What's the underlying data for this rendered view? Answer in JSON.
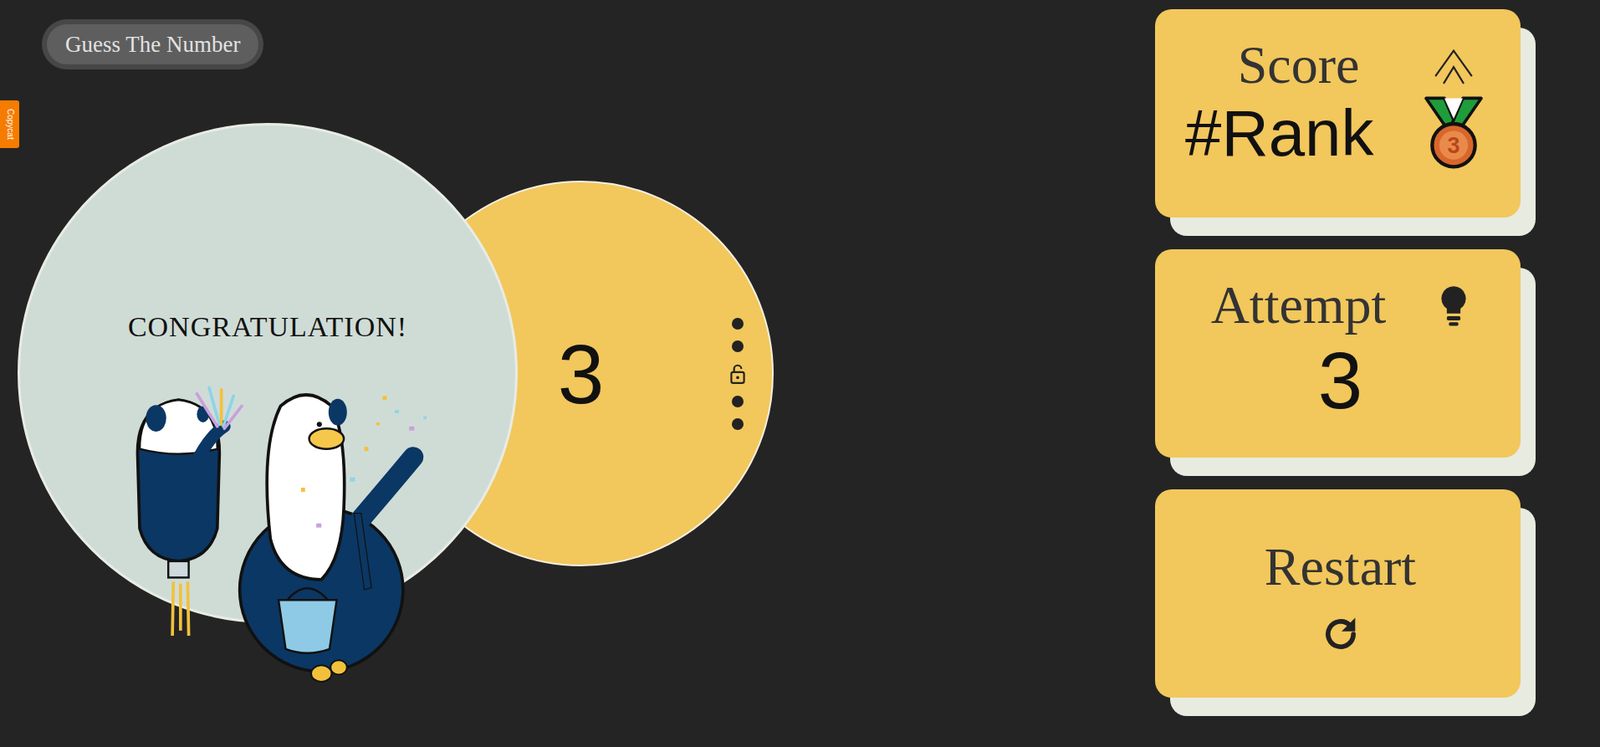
{
  "app": {
    "title": "Guess The Number"
  },
  "side_tab": {
    "label": "Copycat"
  },
  "result": {
    "message": "CONGRATULATION!",
    "number": "3",
    "locked": false
  },
  "cards": [
    {
      "kind": "score",
      "label": "Score",
      "value": "#Rank",
      "medal": "3"
    },
    {
      "kind": "attempt",
      "label": "Attempt",
      "value": "3"
    },
    {
      "kind": "restart",
      "label": "Restart"
    }
  ]
}
